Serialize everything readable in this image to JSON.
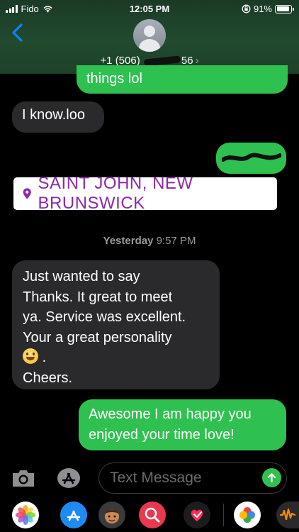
{
  "status_bar": {
    "carrier": "Fido",
    "time": "12:05 PM",
    "battery": "91%",
    "battery_level": 0.91
  },
  "header": {
    "contact_prefix": "+1 (506)",
    "contact_suffix": "56",
    "chevron": "›"
  },
  "messages": [
    {
      "direction": "sent",
      "text": "things lol"
    },
    {
      "direction": "received",
      "text": "I know.loo"
    },
    {
      "direction": "sent",
      "text": ""
    }
  ],
  "location_sticker": {
    "text": "SAINT JOHN, NEW BRUNSWICK"
  },
  "timestamp": {
    "day": "Yesterday",
    "time": "9:57 PM"
  },
  "long_message": {
    "line1": "Just wanted to say",
    "line2": "Thanks. It great to meet",
    "line3": "ya. Service was excellent.",
    "line4": "Your a great personality",
    "line5_after_emoji": ".",
    "line6": "Cheers."
  },
  "reply": {
    "line1": "Awesome I am happy you",
    "line2": "enjoyed your time love!"
  },
  "input": {
    "placeholder": "Text Message"
  },
  "icons": {
    "camera": "camera-icon",
    "appstore": "appstore-icon",
    "send": "arrow-up-icon",
    "photos": "photos-app-icon",
    "memoji": "memoji-app-icon",
    "search": "web-search-app-icon",
    "heart": "digital-touch-app-icon",
    "pinwheel": "google-photos-app-icon",
    "audio": "audio-app-icon"
  },
  "colors": {
    "sent_bubble": "#2fc150",
    "received_bubble": "#2a2a2c",
    "sticker_text": "#8a2aa8"
  }
}
